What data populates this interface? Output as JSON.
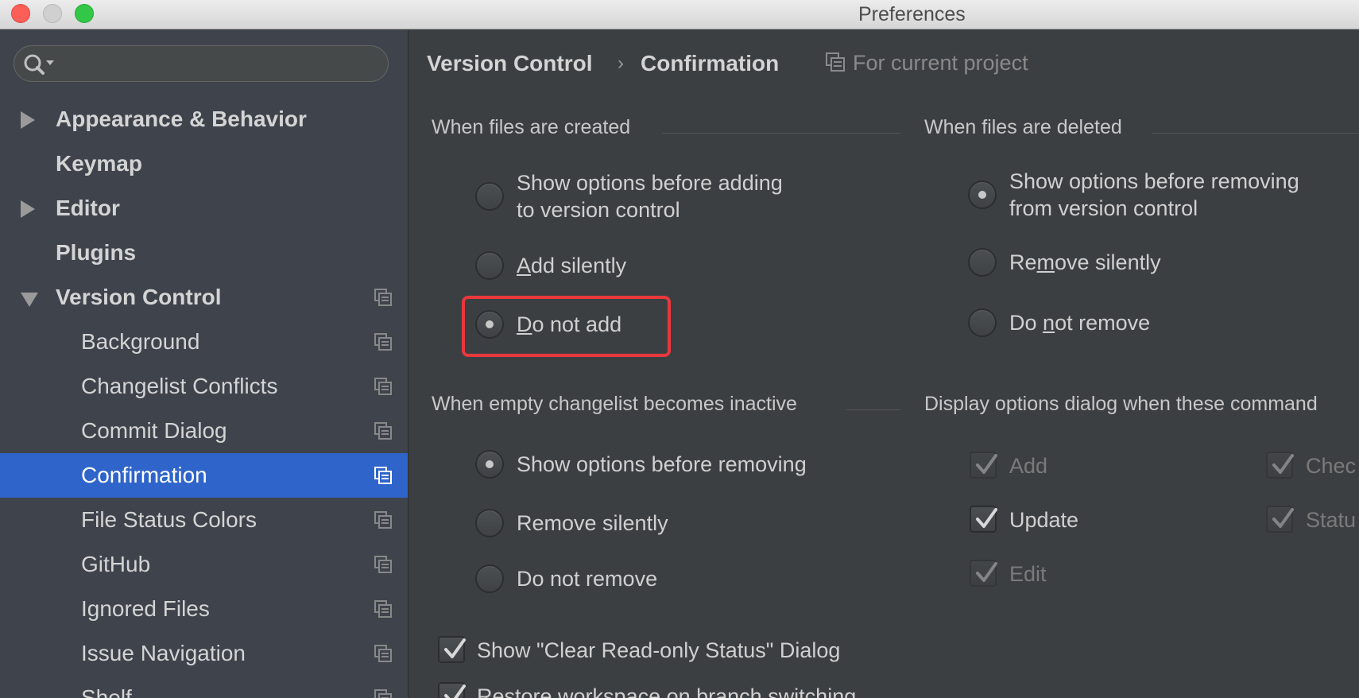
{
  "window": {
    "title": "Preferences"
  },
  "sidebar": {
    "search_placeholder": "",
    "items": [
      {
        "label": "Appearance & Behavior",
        "expandable": "collapsed"
      },
      {
        "label": "Keymap"
      },
      {
        "label": "Editor",
        "expandable": "collapsed"
      },
      {
        "label": "Plugins"
      },
      {
        "label": "Version Control",
        "expandable": "expanded"
      },
      {
        "label": "Background"
      },
      {
        "label": "Changelist Conflicts"
      },
      {
        "label": "Commit Dialog"
      },
      {
        "label": "Confirmation",
        "selected": true
      },
      {
        "label": "File Status Colors"
      },
      {
        "label": "GitHub"
      },
      {
        "label": "Ignored Files"
      },
      {
        "label": "Issue Navigation"
      },
      {
        "label": "Shelf"
      }
    ]
  },
  "breadcrumb": {
    "parent": "Version Control",
    "current": "Confirmation",
    "separator": "›",
    "scope_note": "For current project"
  },
  "created": {
    "title": "When files are created",
    "options": [
      {
        "line1": "Show options before adding",
        "line2": "to version control",
        "checked": false
      },
      {
        "label_u": "A",
        "label_rest": "dd silently",
        "checked": false
      },
      {
        "label_u": "D",
        "label_rest": "o not add",
        "checked": true
      }
    ]
  },
  "deleted": {
    "title": "When files are deleted",
    "options": [
      {
        "line1": "Show options before removing",
        "line2": "from version control",
        "checked": true
      },
      {
        "label_pre": "Re",
        "label_u": "m",
        "label_rest": "ove silently",
        "checked": false
      },
      {
        "label_pre": "Do ",
        "label_u": "n",
        "label_rest": "ot remove",
        "checked": false
      }
    ]
  },
  "empty_changelist": {
    "title": "When empty changelist becomes inactive",
    "options": [
      {
        "label": "Show options before removing",
        "checked": true
      },
      {
        "label": "Remove silently",
        "checked": false
      },
      {
        "label": "Do not remove",
        "checked": false
      }
    ]
  },
  "display_options": {
    "title": "Display options dialog when these command",
    "left": [
      {
        "label": "Add",
        "checked": true,
        "enabled": false
      },
      {
        "label": "Update",
        "checked": true,
        "enabled": true
      },
      {
        "label": "Edit",
        "checked": true,
        "enabled": false
      }
    ],
    "right": [
      {
        "label": "Chec",
        "checked": true,
        "enabled": false
      },
      {
        "label": "Statu",
        "checked": true,
        "enabled": false
      }
    ]
  },
  "bottom": {
    "show_clear_readonly": {
      "label": "Show \"Clear Read-only Status\" Dialog",
      "checked": true
    },
    "restore_workspace": {
      "label": "Restore workspace on branch switching",
      "checked": true
    }
  },
  "colors": {
    "accent": "#2f65ca",
    "highlight": "#e8383d",
    "bg": "#3c3f41",
    "sidebar_bg": "#3e434c"
  }
}
